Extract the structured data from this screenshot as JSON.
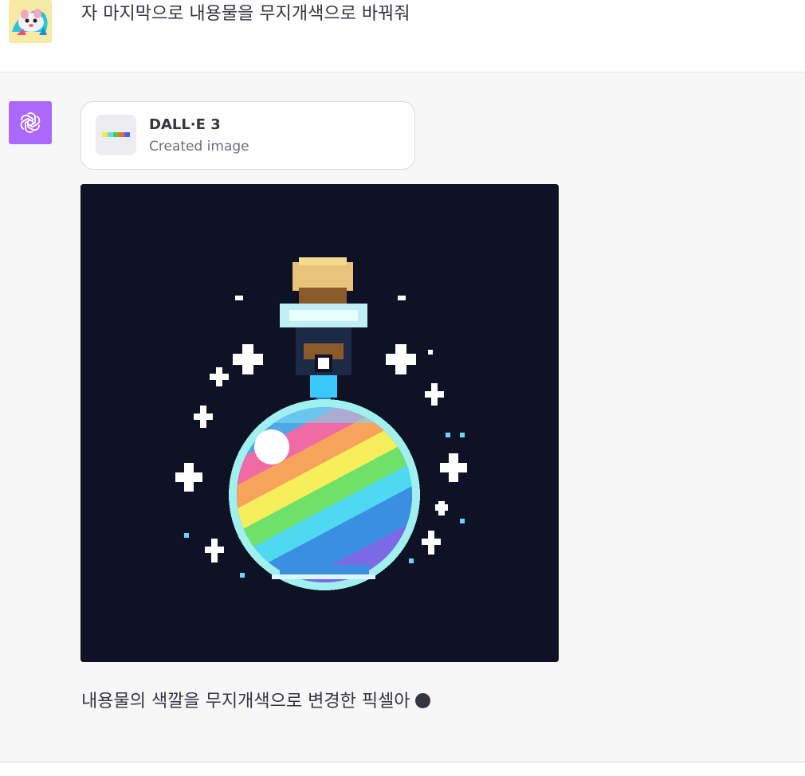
{
  "user": {
    "message": "자 마지막으로 내용물을 무지개색으로 바꿔줘"
  },
  "assistant": {
    "tool": {
      "name": "DALL·E 3",
      "status": "Created image"
    },
    "image_icon": "generated-pixel-art-potion-image",
    "reply": "내용물의 색깔을 무지개색으로 변경한 픽셀아"
  },
  "icons": {
    "user_avatar": "hamster-avatar-icon",
    "assistant_avatar": "openai-logo-icon",
    "cursor": "typing-cursor-dot"
  },
  "colors": {
    "assistant_avatar_bg": "#ab68ff",
    "image_bg": "#0e1224",
    "text": "#343541",
    "muted": "#6e6e80"
  }
}
